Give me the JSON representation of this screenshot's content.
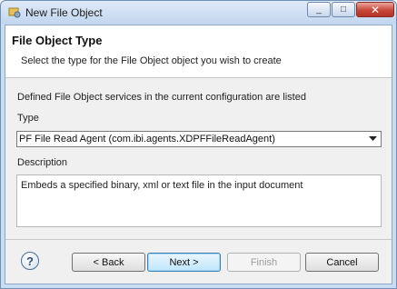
{
  "window": {
    "title": "New File Object",
    "minimize_glyph": "_",
    "maximize_glyph": "□",
    "close_glyph": "✕"
  },
  "header": {
    "title": "File Object Type",
    "subtitle": "Select the type for the File Object object you wish to create"
  },
  "body": {
    "intro": "Defined File Object services in the current configuration are listed",
    "type_label": "Type",
    "type_value": "PF File Read Agent (com.ibi.agents.XDPFFileReadAgent)",
    "description_label": "Description",
    "description_text": "Embeds a specified binary, xml or text file in the input document"
  },
  "footer": {
    "help_glyph": "?",
    "back_label": "< Back",
    "next_label": "Next >",
    "finish_label": "Finish",
    "cancel_label": "Cancel"
  },
  "icons": {
    "app": "folder-gear-icon",
    "help": "help-icon",
    "dropdown": "chevron-down-icon"
  },
  "colors": {
    "title_bar": "#c9dcf1",
    "close_button": "#c8483a",
    "default_button_border": "#3c7fb1"
  }
}
